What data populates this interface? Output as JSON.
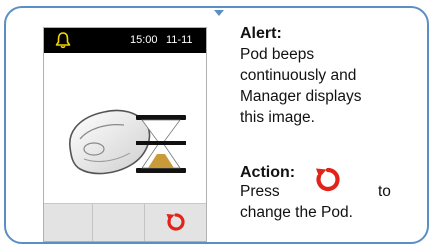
{
  "status_bar": {
    "time": "15:00",
    "date": "11-11"
  },
  "alert": {
    "heading": "Alert:",
    "line1": "Pod beeps",
    "line2": "continuously and",
    "line3": "Manager displays",
    "line4": "this image."
  },
  "action": {
    "heading": "Action:",
    "press": "Press",
    "to": "to",
    "rest": "change the Pod."
  },
  "icons": {
    "bell": "bell-icon",
    "rotate": "rotate-arrow-icon",
    "pod": "pod-hourglass-image"
  },
  "colors": {
    "frame_border": "#5b8fc4",
    "rotate_red": "#e2231a",
    "hourglass_gold": "#c99a3a"
  }
}
